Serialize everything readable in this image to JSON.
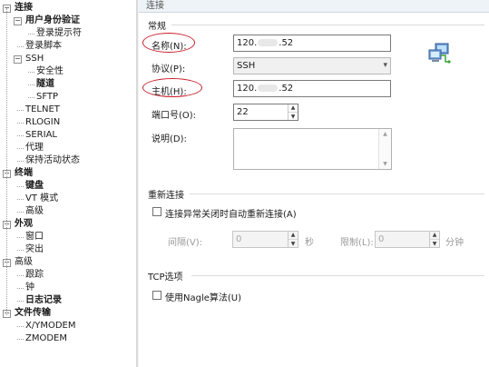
{
  "tree": {
    "items": [
      {
        "label": "连接",
        "indent": 0,
        "expand": "−",
        "bold": true
      },
      {
        "label": "用户身份验证",
        "indent": 1,
        "expand": "−",
        "bold": true
      },
      {
        "label": "登录提示符",
        "indent": 2,
        "expand": "",
        "bold": false
      },
      {
        "label": "登录脚本",
        "indent": 1,
        "expand": "",
        "bold": false
      },
      {
        "label": "SSH",
        "indent": 1,
        "expand": "−",
        "bold": false
      },
      {
        "label": "安全性",
        "indent": 2,
        "expand": "",
        "bold": false
      },
      {
        "label": "隧道",
        "indent": 2,
        "expand": "",
        "bold": true
      },
      {
        "label": "SFTP",
        "indent": 2,
        "expand": "",
        "bold": false
      },
      {
        "label": "TELNET",
        "indent": 1,
        "expand": "",
        "bold": false
      },
      {
        "label": "RLOGIN",
        "indent": 1,
        "expand": "",
        "bold": false
      },
      {
        "label": "SERIAL",
        "indent": 1,
        "expand": "",
        "bold": false
      },
      {
        "label": "代理",
        "indent": 1,
        "expand": "",
        "bold": false
      },
      {
        "label": "保持活动状态",
        "indent": 1,
        "expand": "",
        "bold": false
      },
      {
        "label": "终端",
        "indent": 0,
        "expand": "−",
        "bold": true
      },
      {
        "label": "键盘",
        "indent": 1,
        "expand": "",
        "bold": true
      },
      {
        "label": "VT 模式",
        "indent": 1,
        "expand": "",
        "bold": false
      },
      {
        "label": "高级",
        "indent": 1,
        "expand": "",
        "bold": false
      },
      {
        "label": "外观",
        "indent": 0,
        "expand": "−",
        "bold": true
      },
      {
        "label": "窗口",
        "indent": 1,
        "expand": "",
        "bold": false
      },
      {
        "label": "突出",
        "indent": 1,
        "expand": "",
        "bold": false
      },
      {
        "label": "高级",
        "indent": 0,
        "expand": "−",
        "bold": false
      },
      {
        "label": "跟踪",
        "indent": 1,
        "expand": "",
        "bold": false
      },
      {
        "label": "钟",
        "indent": 1,
        "expand": "",
        "bold": false
      },
      {
        "label": "日志记录",
        "indent": 1,
        "expand": "",
        "bold": true
      },
      {
        "label": "文件传输",
        "indent": 0,
        "expand": "−",
        "bold": true
      },
      {
        "label": "X/YMODEM",
        "indent": 1,
        "expand": "",
        "bold": false
      },
      {
        "label": "ZMODEM",
        "indent": 1,
        "expand": "",
        "bold": false
      }
    ]
  },
  "breadcrumb": "连接",
  "general": {
    "title": "常规",
    "name_label": "名称(N):",
    "name_value_prefix": "120.",
    "name_value_suffix": ".52",
    "protocol_label": "协议(P):",
    "protocol_value": "SSH",
    "host_label": "主机(H):",
    "host_value_prefix": "120.",
    "host_value_suffix": ".52",
    "port_label": "端口号(O):",
    "port_value": "22",
    "desc_label": "说明(D):"
  },
  "reconnect": {
    "title": "重新连接",
    "checkbox_label": "连接异常关闭时自动重新连接(A)",
    "interval_label": "间隔(V):",
    "interval_value": "0",
    "interval_unit": "秒",
    "limit_label": "限制(L):",
    "limit_value": "0",
    "limit_unit": "分钟"
  },
  "tcp": {
    "title": "TCP选项",
    "nagle_label": "使用Nagle算法(U)"
  },
  "icons": {
    "network": "network-computer-icon",
    "caret": "▾",
    "spin_up": "▲",
    "spin_down": "▼"
  },
  "colors": {
    "highlight_oval": "#c8202a",
    "breadcrumb_bg": "#eef3f8"
  }
}
